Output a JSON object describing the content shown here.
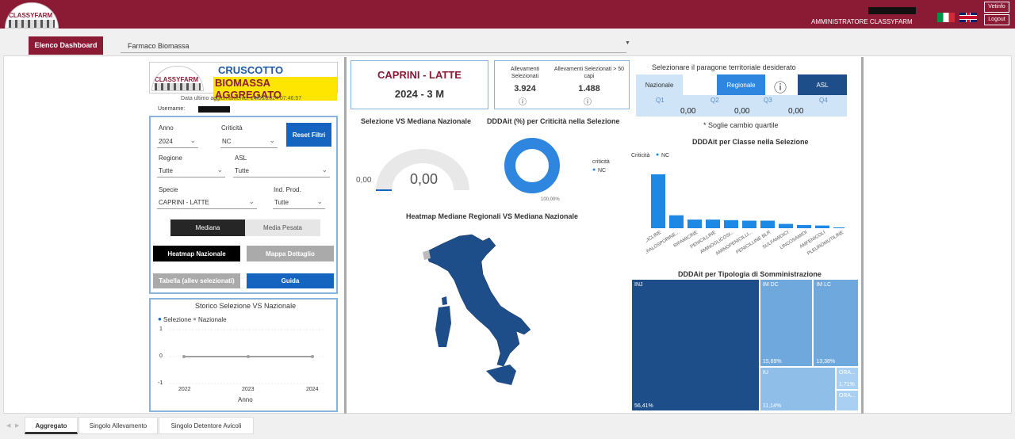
{
  "header": {
    "logo_text": "CLASSYFARM",
    "user_role": "AMMINISTRATORE CLASSYFARM",
    "btn_vetinfo": "Vetinfo",
    "btn_logout": "Logout"
  },
  "nav": {
    "elenco_label": "Elenco Dashboard",
    "dashboard_select": "Farmaco Biomassa"
  },
  "title": {
    "line1": "CRUSCOTTO FARMACO",
    "line2": "BIOMASSA AGGREGATO",
    "logo_text": "CLASSYFARM",
    "update": "Data ultimo aggiornamento: 24/05/2024 07:46:57",
    "username_label": "Username:"
  },
  "filters": {
    "anno_label": "Anno",
    "anno_value": "2024",
    "criticita_label": "Criticità",
    "criticita_value": "NC",
    "reset_label": "Reset Filtri",
    "regione_label": "Regione",
    "regione_value": "Tutte",
    "asl_label": "ASL",
    "asl_value": "Tutte",
    "specie_label": "Specie",
    "specie_value": "CAPRINI - LATTE",
    "indprod_label": "Ind. Prod.",
    "indprod_value": "Tutte",
    "mediana_label": "Mediana",
    "media_pesata_label": "Media Pesata",
    "heatmap_label": "Heatmap Nazionale",
    "mappa_label": "Mappa Dettaglio",
    "tabella_label": "Tabella (allev selezionati)",
    "guida_label": "Guida"
  },
  "storico": {
    "title": "Storico Selezione VS Nazionale",
    "legend_sel": "Selezione",
    "legend_naz": "Nazionale",
    "y_ticks": [
      "1",
      "0",
      "-1"
    ],
    "x_ticks": [
      "2022",
      "2023",
      "2024"
    ],
    "xlabel": "Anno",
    "colors": {
      "selezione": "#1565c0",
      "nazionale": "#a0a0a0"
    }
  },
  "species_card": {
    "title": "CAPRINI - LATTE",
    "period": "2024 - 3 M"
  },
  "allev_card": {
    "label1": "Allevamenti Selezionati",
    "value1": "3.924",
    "label2": "Allevamenti Selezionati > 50 capi",
    "value2": "1.488"
  },
  "gauge": {
    "title": "Selezione VS Mediana Nazionale",
    "min_label": "0,00",
    "value_label": "0,00",
    "value": 0
  },
  "donut": {
    "title": "DDDAit (%) per Criticità nella Selezione",
    "legend_title": "criticità",
    "legend_item": "NC",
    "pct_label": "100,00%",
    "color": "#2e86de"
  },
  "map": {
    "title": "Heatmap Mediane Regionali VS Mediana Nazionale",
    "color": "#1d4e89"
  },
  "territorial": {
    "title": "Selezionare il paragone territoriale desiderato",
    "nazionale": "Nazionale",
    "regionale": "Regionale",
    "asl": "ASL",
    "quartiles": [
      "Q1",
      "Q2",
      "Q3",
      "Q4"
    ],
    "values": [
      "0,00",
      "0,00",
      "0,00"
    ],
    "note": "* Soglie cambio quartile"
  },
  "chart_data": [
    {
      "type": "bar",
      "title": "DDDAit per Classe nella Selezione",
      "legend_title": "Criticità",
      "legend": "NC",
      "categories": [
        "TETRACICLINE",
        "CEFALOSPORINE...",
        "RIFAMICINE",
        "PENICILLINE",
        "AMINOGLICOSI...",
        "AMINOPENICILLI...",
        "PENICILLINE BLR",
        "SULFAMIDICI",
        "LINCOSAMIDI",
        "AMFENICOLI",
        "PLEUROMUTILINE"
      ],
      "values": [
        100,
        24,
        16,
        16,
        15,
        14,
        14,
        8,
        6,
        5,
        1
      ],
      "color": "#1e88e5"
    },
    {
      "type": "treemap",
      "title": "DDDAit per Tipologia di Somministrazione",
      "items": [
        {
          "name": "INJ",
          "value": 56.41,
          "label": "56,41%",
          "color": "#1d4e89"
        },
        {
          "name": "IM DC",
          "value": 15.69,
          "label": "15,69%",
          "color": "#6fa8dc"
        },
        {
          "name": "IM LC",
          "value": 13.38,
          "label": "13,38%",
          "color": "#6fa8dc"
        },
        {
          "name": "IU",
          "value": 11.14,
          "label": "11,14%",
          "color": "#8fbfe9"
        },
        {
          "name": "ORA...",
          "value": 1.71,
          "label": "1,71%",
          "color": "#a9d0f2"
        },
        {
          "name": "ORA...",
          "value": 1.67,
          "label": "",
          "color": "#a9d0f2"
        }
      ]
    }
  ],
  "tabs": [
    "Aggregato",
    "Singolo Allevamento",
    "Singolo Detentore Avicoli"
  ]
}
